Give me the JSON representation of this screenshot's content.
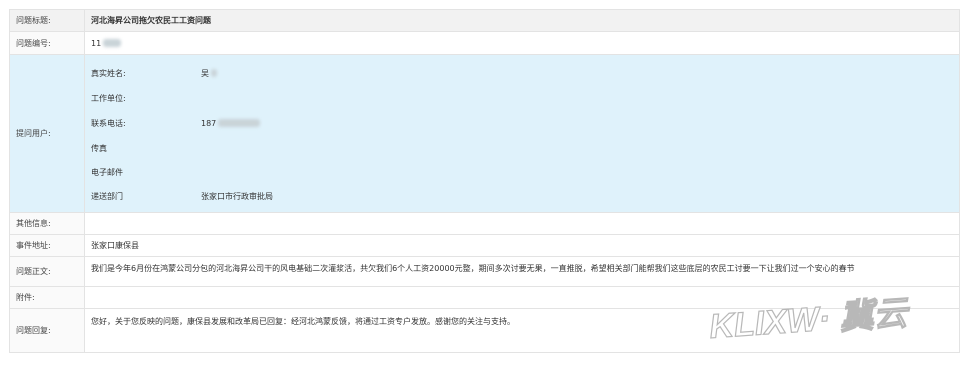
{
  "rows": {
    "title": {
      "label": "问题标题:",
      "value": "河北海昇公司拖欠农民工工资问题"
    },
    "number": {
      "label": "问题编号:",
      "value": "11"
    },
    "user": {
      "label": "提问用户:",
      "fields": [
        {
          "key": "真实姓名:",
          "value": "吴"
        },
        {
          "key": "工作单位:",
          "value": ""
        },
        {
          "key": "联系电话:",
          "value": "187"
        },
        {
          "key": "传真",
          "value": ""
        },
        {
          "key": "电子邮件",
          "value": ""
        },
        {
          "key": "递送部门",
          "value": "张家口市行政审批局"
        }
      ]
    },
    "other": {
      "label": "其他信息:",
      "value": ""
    },
    "address": {
      "label": "事件地址:",
      "value": "张家口康保县"
    },
    "body": {
      "label": "问题正文:",
      "value": "我们是今年6月份在鸿蒙公司分包的河北海昇公司干的风电基础二次灌浆活，共欠我们6个人工资20000元整，期间多次讨要无果，一直推脱，希望相关部门能帮我们这些底层的农民工讨要一下让我们过一个安心的春节"
    },
    "attachment": {
      "label": "附件:",
      "value": ""
    },
    "reply": {
      "label": "问题回复:",
      "value": "您好，关于您反映的问题，康保县发展和改革局已回复：经河北鸿蒙反馈，将通过工资专户发放。感谢您的关注与支持。"
    }
  },
  "watermark": {
    "text": "KLIXW· 冀云"
  }
}
